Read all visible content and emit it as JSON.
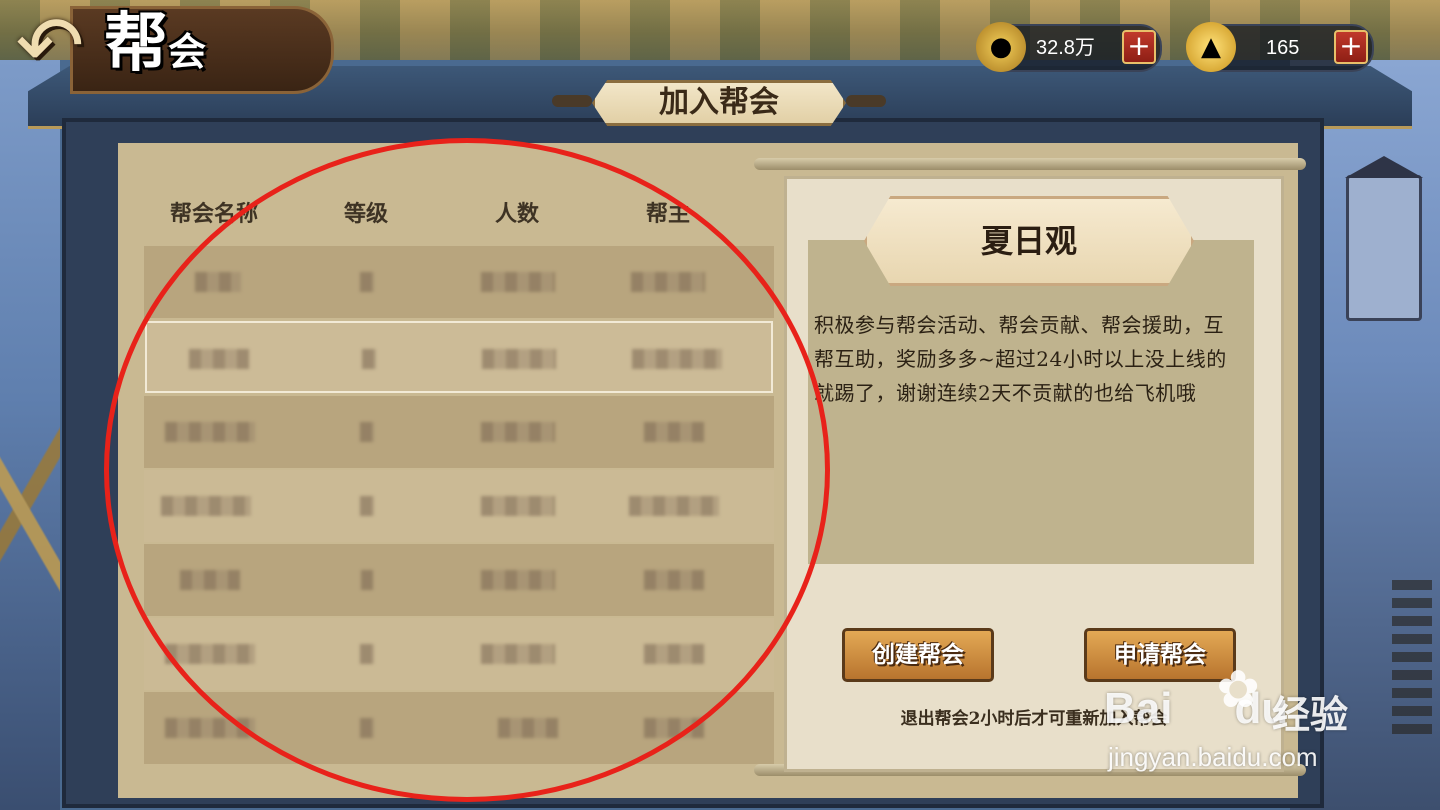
{
  "header": {
    "title_main": "帮",
    "title_sub": "会",
    "back_icon": "back-arrow-icon"
  },
  "currency": {
    "coins": {
      "icon": "coin-icon",
      "value": "32.8万"
    },
    "gold": {
      "icon": "gold-ingot-icon",
      "value": "165"
    },
    "plus_label": "+"
  },
  "panel": {
    "title": "加入帮会"
  },
  "guild_table": {
    "columns": [
      "帮会名称",
      "等级",
      "人数",
      "帮主"
    ],
    "rows_note_blurred": true,
    "row_count": 7,
    "selected_row": 2
  },
  "guild_detail": {
    "name": "夏日观",
    "description": "积极参与帮会活动、帮会贡献、帮会援助，互帮互助，奖励多多~超过24小时以上没上线的就踢了，谢谢连续2天不贡献的也给飞机哦",
    "create_button": "创建帮会",
    "apply_button": "申请帮会",
    "note": "退出帮会2小时后才可重新加入帮会"
  },
  "annotation": {
    "color": "#e8221a",
    "shape": "red-circle"
  },
  "watermark": {
    "logo": "Bai",
    "logo_suffix": "du",
    "brand_cn": "经验",
    "url": "jingyan.baidu.com"
  }
}
